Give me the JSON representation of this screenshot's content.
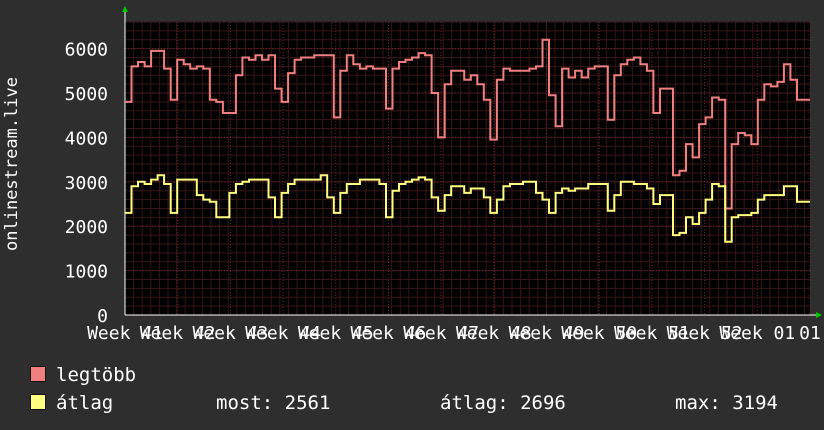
{
  "ylabel": "onlinestream.live",
  "legend": [
    {
      "label": "legtöbb",
      "color": "#f08080"
    },
    {
      "label": "átlag",
      "color": "#ffff80"
    }
  ],
  "stats": {
    "most": "most: 2561",
    "atlag": "átlag: 2696",
    "max": "max: 3194"
  },
  "chart_data": {
    "type": "line",
    "ylim": [
      0,
      6600
    ],
    "yticks": [
      0,
      1000,
      2000,
      3000,
      4000,
      5000,
      6000
    ],
    "xticks": [
      "Week 41",
      "Week 42",
      "Week 43",
      "Week 44",
      "Week 45",
      "Week 46",
      "Week 47",
      "Week 48",
      "Week 49",
      "Week 50",
      "Week 51",
      "Week 52",
      "Week 01",
      "01"
    ],
    "grid": true,
    "series": [
      {
        "name": "legtöbb",
        "color": "#f08080",
        "values": [
          4800,
          5600,
          5700,
          5600,
          5950,
          5950,
          5550,
          4850,
          5750,
          5650,
          5550,
          5600,
          5550,
          4850,
          4800,
          4550,
          4550,
          5400,
          5800,
          5750,
          5850,
          5750,
          5850,
          5100,
          4800,
          5450,
          5750,
          5800,
          5800,
          5850,
          5850,
          5850,
          4450,
          5500,
          5850,
          5650,
          5550,
          5600,
          5550,
          5550,
          4650,
          5550,
          5700,
          5750,
          5800,
          5900,
          5850,
          5000,
          4000,
          5200,
          5500,
          5500,
          5300,
          5400,
          5200,
          4850,
          3950,
          5300,
          5550,
          5500,
          5500,
          5500,
          5550,
          5600,
          6200,
          4950,
          4250,
          5550,
          5350,
          5500,
          5350,
          5550,
          5600,
          5600,
          4400,
          5400,
          5650,
          5750,
          5800,
          5650,
          5500,
          4550,
          5100,
          5100,
          3150,
          3250,
          3850,
          3550,
          4300,
          4450,
          4900,
          4850,
          2400,
          3850,
          4100,
          4050,
          3850,
          4850,
          5200,
          5150,
          5250,
          5650,
          5300,
          4850,
          4850
        ]
      },
      {
        "name": "átlag",
        "color": "#ffff80",
        "values": [
          2300,
          2900,
          3000,
          2950,
          3050,
          3150,
          2950,
          2300,
          3050,
          3050,
          3050,
          2700,
          2600,
          2550,
          2200,
          2200,
          2750,
          2950,
          3000,
          3050,
          3050,
          3050,
          2650,
          2200,
          2750,
          2950,
          3050,
          3050,
          3050,
          3050,
          3150,
          2650,
          2300,
          2750,
          2950,
          2950,
          3050,
          3050,
          3050,
          2950,
          2200,
          2800,
          2950,
          3000,
          3050,
          3100,
          3050,
          2650,
          2350,
          2700,
          2900,
          2900,
          2750,
          2850,
          2850,
          2650,
          2300,
          2600,
          2900,
          2950,
          2950,
          3000,
          3000,
          2750,
          2600,
          2300,
          2750,
          2850,
          2800,
          2850,
          2850,
          2950,
          2950,
          2950,
          2350,
          2700,
          3000,
          3000,
          2950,
          2950,
          2850,
          2500,
          2700,
          2700,
          1800,
          1850,
          2200,
          2050,
          2300,
          2600,
          2950,
          2900,
          1650,
          2200,
          2250,
          2250,
          2300,
          2600,
          2700,
          2700,
          2700,
          2900,
          2900,
          2550,
          2550
        ]
      }
    ]
  }
}
